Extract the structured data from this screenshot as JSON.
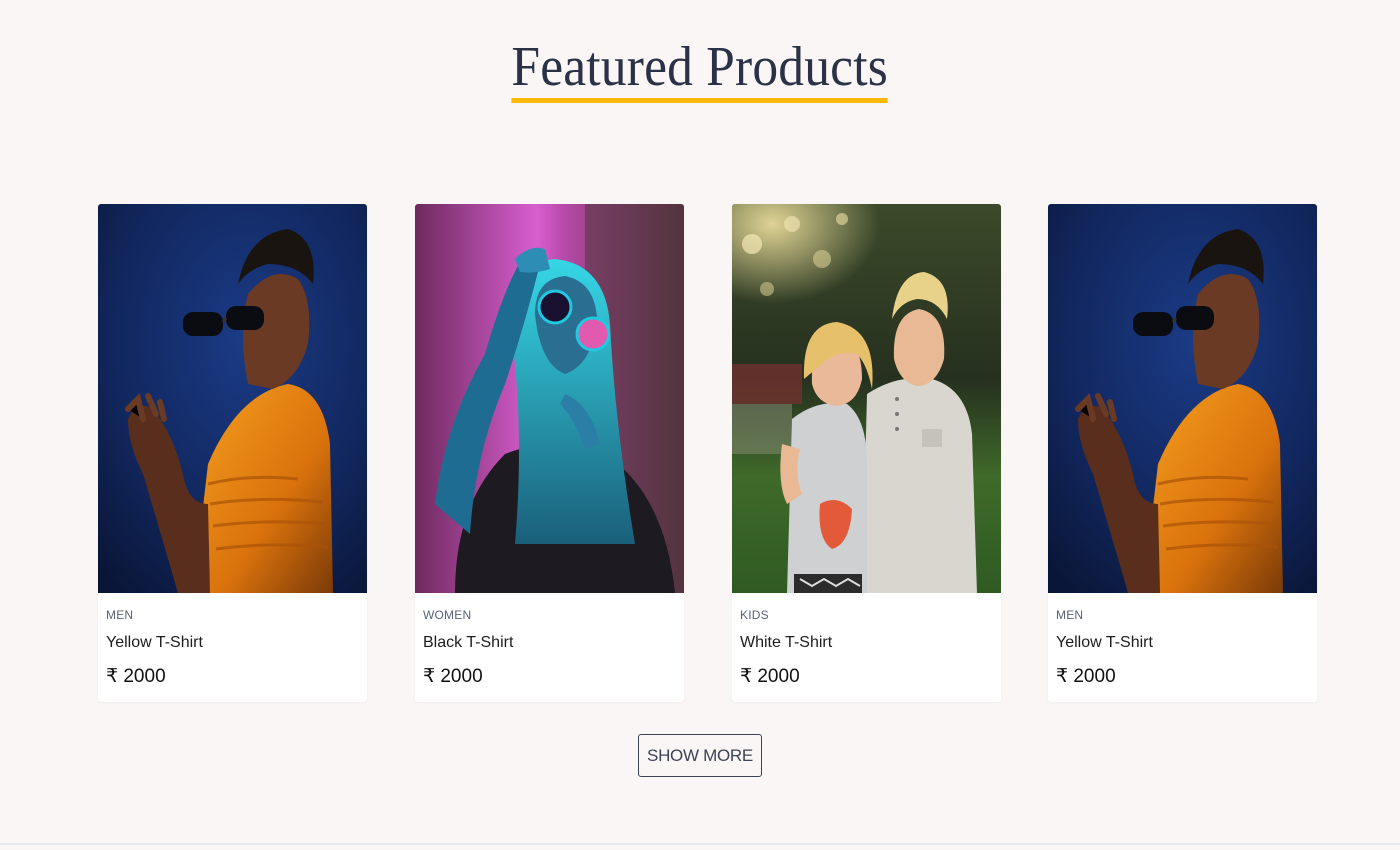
{
  "section": {
    "title": "Featured Products",
    "accent_color": "#ffb800",
    "title_color": "#2b3247"
  },
  "products": [
    {
      "category": "MEN",
      "name": "Yellow T-Shirt",
      "price": "₹ 2000",
      "image": "man-orange-sweater-photo"
    },
    {
      "category": "WOMEN",
      "name": "Black T-Shirt",
      "price": "₹ 2000",
      "image": "woman-neon-sunglasses-photo"
    },
    {
      "category": "KIDS",
      "name": "White T-Shirt",
      "price": "₹ 2000",
      "image": "two-kids-outdoor-photo"
    },
    {
      "category": "MEN",
      "name": "Yellow T-Shirt",
      "price": "₹ 2000",
      "image": "man-orange-sweater-photo"
    }
  ],
  "actions": {
    "show_more_label": "SHOW MORE"
  }
}
